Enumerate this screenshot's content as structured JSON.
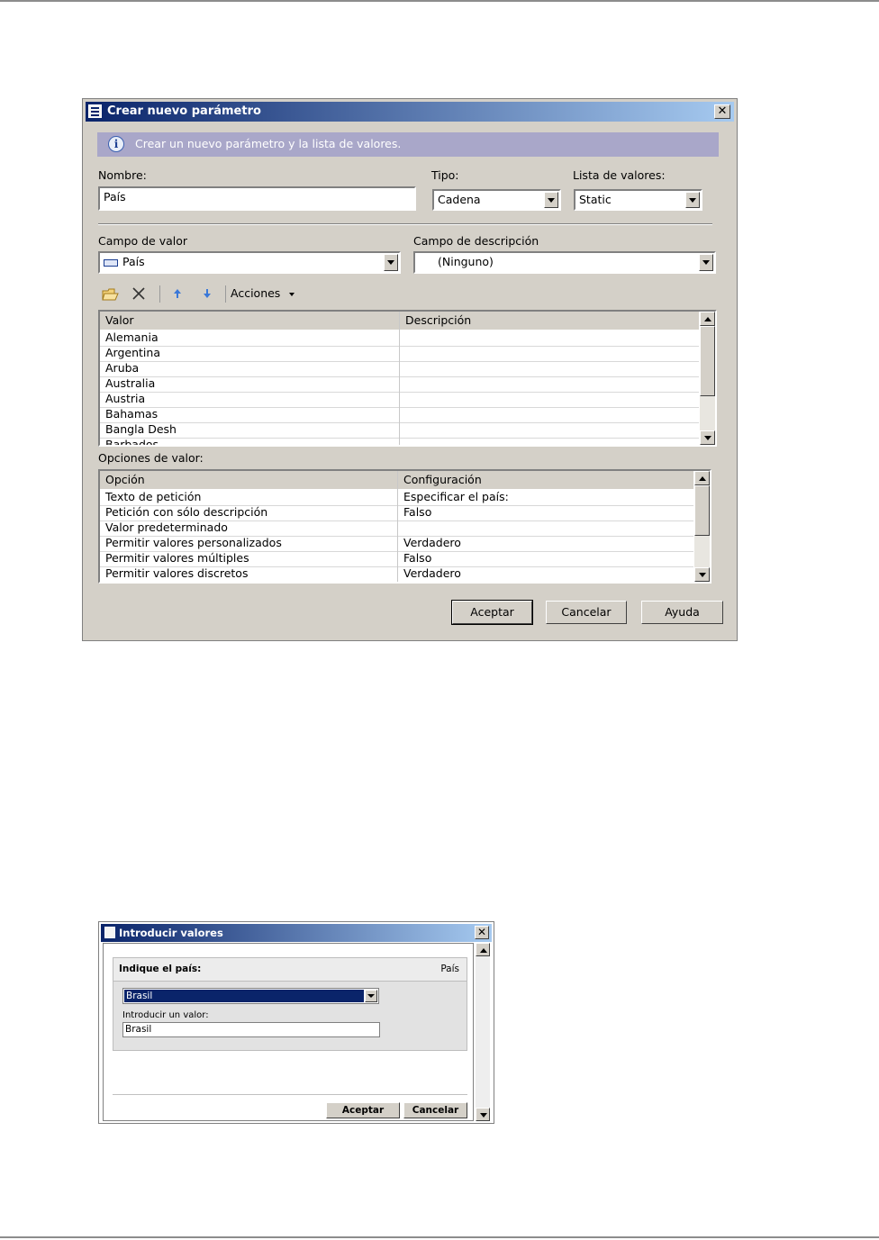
{
  "dialog1": {
    "title": "Crear nuevo parámetro",
    "info_text": "Crear un nuevo parámetro y la lista de valores.",
    "nombre_label": "Nombre:",
    "nombre_value": "País",
    "tipo_label": "Tipo:",
    "tipo_value": "Cadena",
    "lista_label": "Lista de valores:",
    "lista_value": "Static",
    "campo_valor_label": "Campo de valor",
    "campo_valor_value": "País",
    "campo_desc_label": "Campo de descripción",
    "campo_desc_value": "(Ninguno)",
    "toolbar": {
      "acciones_label": "Acciones"
    },
    "values_table": {
      "col_valor": "Valor",
      "col_descripcion": "Descripción",
      "rows": [
        {
          "valor": "Alemania",
          "descripcion": ""
        },
        {
          "valor": "Argentina",
          "descripcion": ""
        },
        {
          "valor": "Aruba",
          "descripcion": ""
        },
        {
          "valor": "Australia",
          "descripcion": ""
        },
        {
          "valor": "Austria",
          "descripcion": ""
        },
        {
          "valor": "Bahamas",
          "descripcion": ""
        },
        {
          "valor": "Bangla Desh",
          "descripcion": ""
        },
        {
          "valor": "Barbados",
          "descripcion": ""
        }
      ]
    },
    "options_label": "Opciones de valor:",
    "options_table": {
      "col_opcion": "Opción",
      "col_config": "Configuración",
      "rows": [
        {
          "opcion": "Texto de petición",
          "config": "Especificar el país:"
        },
        {
          "opcion": "Petición con sólo descripción",
          "config": "Falso"
        },
        {
          "opcion": "Valor predeterminado",
          "config": ""
        },
        {
          "opcion": "Permitir valores personalizados",
          "config": "Verdadero"
        },
        {
          "opcion": "Permitir valores múltiples",
          "config": "Falso"
        },
        {
          "opcion": "Permitir valores discretos",
          "config": "Verdadero"
        }
      ]
    },
    "buttons": {
      "aceptar": "Aceptar",
      "cancelar": "Cancelar",
      "ayuda": "Ayuda"
    }
  },
  "dialog2": {
    "title": "Introducir valores",
    "prompt_label": "Indique el país:",
    "param_name": "País",
    "select_value": "Brasil",
    "input_label": "Introducir un valor:",
    "input_value": "Brasil",
    "buttons": {
      "aceptar": "Aceptar",
      "cancelar": "Cancelar"
    }
  },
  "colors": {
    "title_start": "#0a246a",
    "title_end": "#a6caf0",
    "info_bar": "#a9a7c9",
    "dialog_face": "#d4d0c8"
  }
}
